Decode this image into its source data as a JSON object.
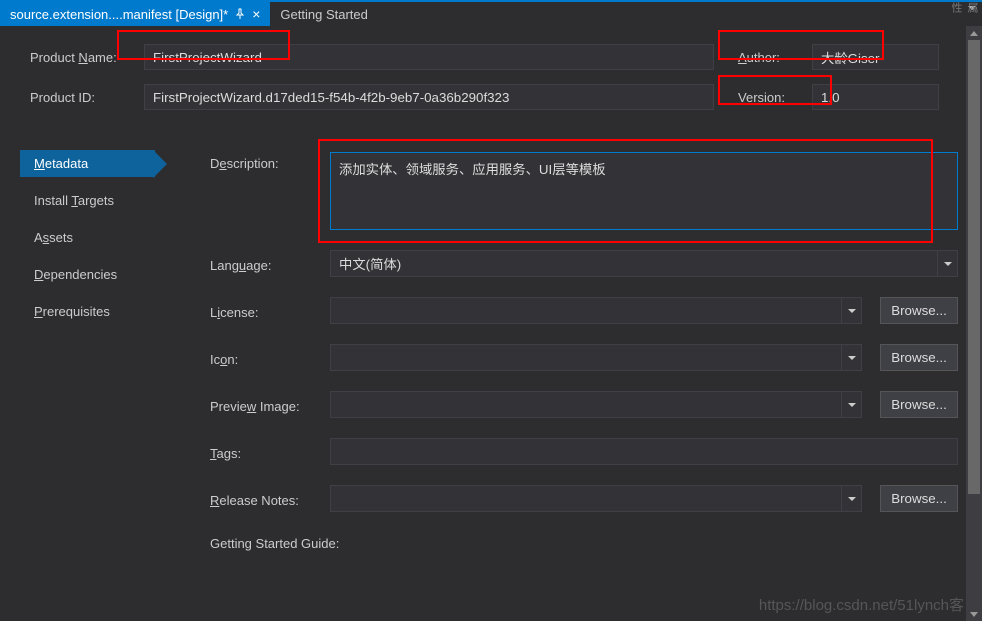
{
  "tabs": {
    "active": "source.extension....manifest [Design]*",
    "inactive": "Getting Started"
  },
  "header": {
    "product_name_label": "Product Name:",
    "product_name_value": "FirstProjectWizard",
    "author_label": "Author:",
    "author_value": "大龄Giser",
    "product_id_label": "Product ID:",
    "product_id_value": "FirstProjectWizard.d17ded15-f54b-4f2b-9eb7-0a36b290f323",
    "version_label": "Version:",
    "version_value": "1.0"
  },
  "sidebar": {
    "items": [
      {
        "label": "Metadata",
        "active": true
      },
      {
        "label": "Install Targets"
      },
      {
        "label": "Assets"
      },
      {
        "label": "Dependencies"
      },
      {
        "label": "Prerequisites"
      }
    ]
  },
  "main": {
    "description_label": "Description:",
    "description_value": "添加实体、领域服务、应用服务、UI层等模板",
    "language_label": "Language:",
    "language_value": "中文(简体)",
    "license_label": "License:",
    "license_value": "",
    "icon_label": "Icon:",
    "icon_value": "",
    "preview_label": "Preview Image:",
    "preview_value": "",
    "tags_label": "Tags:",
    "tags_value": "",
    "release_notes_label": "Release Notes:",
    "release_notes_value": "",
    "getting_started_label": "Getting Started Guide:",
    "browse_label": "Browse..."
  },
  "watermark": "https://blog.csdn.net/51lynch客"
}
